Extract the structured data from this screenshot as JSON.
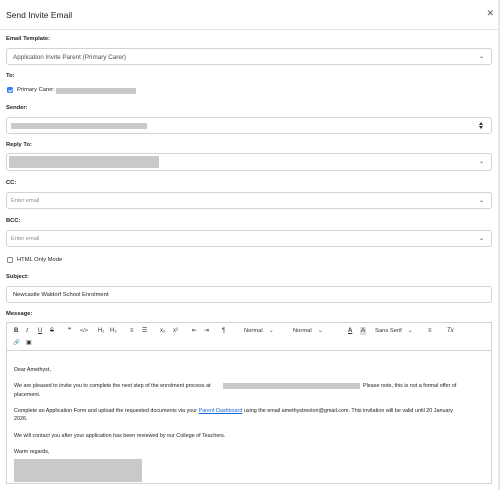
{
  "dialog": {
    "title": "Send Invite Email",
    "close_glyph": "✕"
  },
  "email_template": {
    "label": "Email Template:",
    "value": "Application Invite Parent (Primary Carer)"
  },
  "to": {
    "label": "To:",
    "recipient_prefix": "Primary Carer:",
    "checked": true
  },
  "sender": {
    "label": "Sender:"
  },
  "reply_to": {
    "label": "Reply To:"
  },
  "cc": {
    "label": "CC:",
    "placeholder": "Enter email"
  },
  "bcc": {
    "label": "BCC:",
    "placeholder": "Enter email"
  },
  "html_only": {
    "label": "HTML Only Mode",
    "checked": false
  },
  "subject": {
    "label": "Subject:",
    "value": "Newcastle Waldorf School Enrolment"
  },
  "message": {
    "label": "Message:",
    "toolbar": {
      "bold": "B",
      "italic": "I",
      "underline": "U",
      "strike": "S",
      "blockquote": "❞",
      "code": "</>",
      "h1": "H₁",
      "h2": "H₂",
      "ordered_list": "≡",
      "bullet_list": "☰",
      "subscript": "x₂",
      "superscript": "x²",
      "outdent": "⇤",
      "indent": "⇥",
      "direction": "¶",
      "size_select": "Normal",
      "header_select": "Normal",
      "font_color": "A",
      "background_color": "A",
      "font_select": "Sans Serif",
      "align": "≡",
      "clean": "Tx",
      "link": "🔗",
      "image": "▣"
    },
    "body": {
      "greeting": "Dear Amethyst,",
      "para1_a": "We are pleased to invite you to complete the next step of the enrolment process at",
      "para1_b": "Please note, this is not a formal offer of",
      "para1_c": "placement.",
      "para2_a": "Complete an Application Form and upload the requested documents via your",
      "para2_link": "Parent Dashboard",
      "para2_b": "using the email amethystreolon@gmail.com. This invitation will be valid until 20 January",
      "para2_c": "2026.",
      "para3": "We will contact you after your application has been reviewed by our College of Teachers.",
      "closing": "Warm regards,"
    }
  }
}
